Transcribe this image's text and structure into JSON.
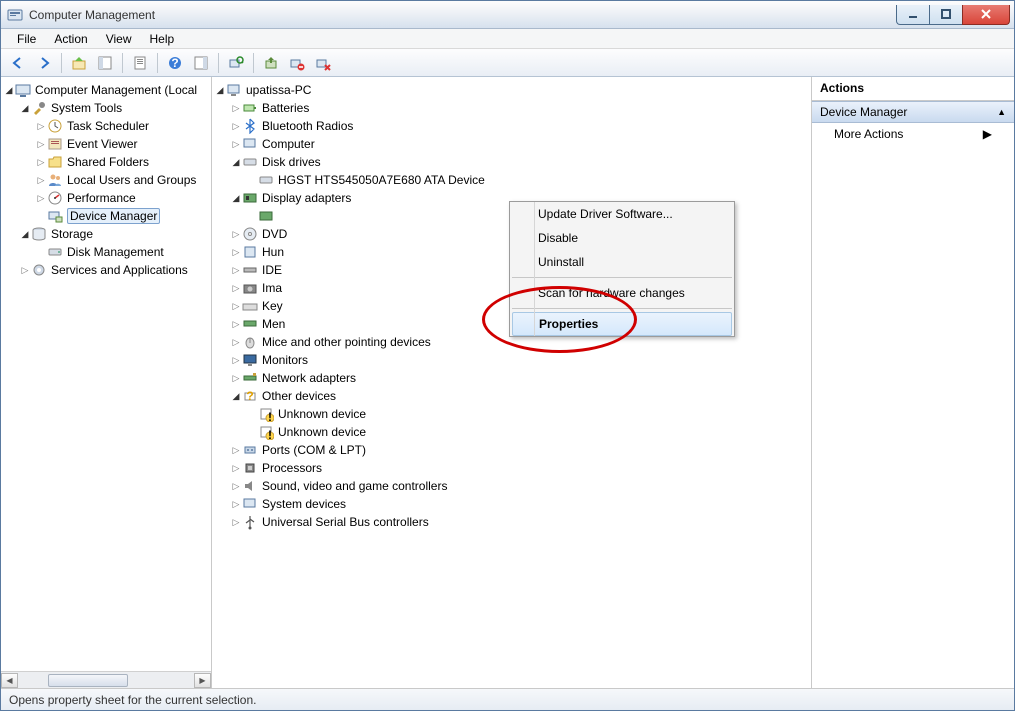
{
  "window": {
    "title": "Computer Management"
  },
  "menu": {
    "file": "File",
    "action": "Action",
    "view": "View",
    "help": "Help"
  },
  "left_tree": {
    "root": "Computer Management (Local",
    "system_tools": "System Tools",
    "task_scheduler": "Task Scheduler",
    "event_viewer": "Event Viewer",
    "shared_folders": "Shared Folders",
    "local_users": "Local Users and Groups",
    "performance": "Performance",
    "device_manager": "Device Manager",
    "storage": "Storage",
    "disk_management": "Disk Management",
    "services_apps": "Services and Applications"
  },
  "mid_tree": {
    "root": "upatissa-PC",
    "batteries": "Batteries",
    "bluetooth": "Bluetooth Radios",
    "computer": "Computer",
    "disk_drives": "Disk drives",
    "disk_model": "HGST HTS545050A7E680 ATA Device",
    "display_adapters": "Display adapters",
    "dvd": "DVD",
    "hum": "Hun",
    "ide": "IDE",
    "ima": "Ima",
    "key": "Key",
    "mem": "Men",
    "mice": "Mice and other pointing devices",
    "monitors": "Monitors",
    "network": "Network adapters",
    "other_devices": "Other devices",
    "unknown1": "Unknown device",
    "unknown2": "Unknown device",
    "ports": "Ports (COM & LPT)",
    "processors": "Processors",
    "sound": "Sound, video and game controllers",
    "system_devices": "System devices",
    "usb": "Universal Serial Bus controllers"
  },
  "context_menu": {
    "update": "Update Driver Software...",
    "disable": "Disable",
    "uninstall": "Uninstall",
    "scan": "Scan for hardware changes",
    "properties": "Properties"
  },
  "actions": {
    "title": "Actions",
    "subtitle": "Device Manager",
    "more": "More Actions"
  },
  "status": "Opens property sheet for the current selection."
}
